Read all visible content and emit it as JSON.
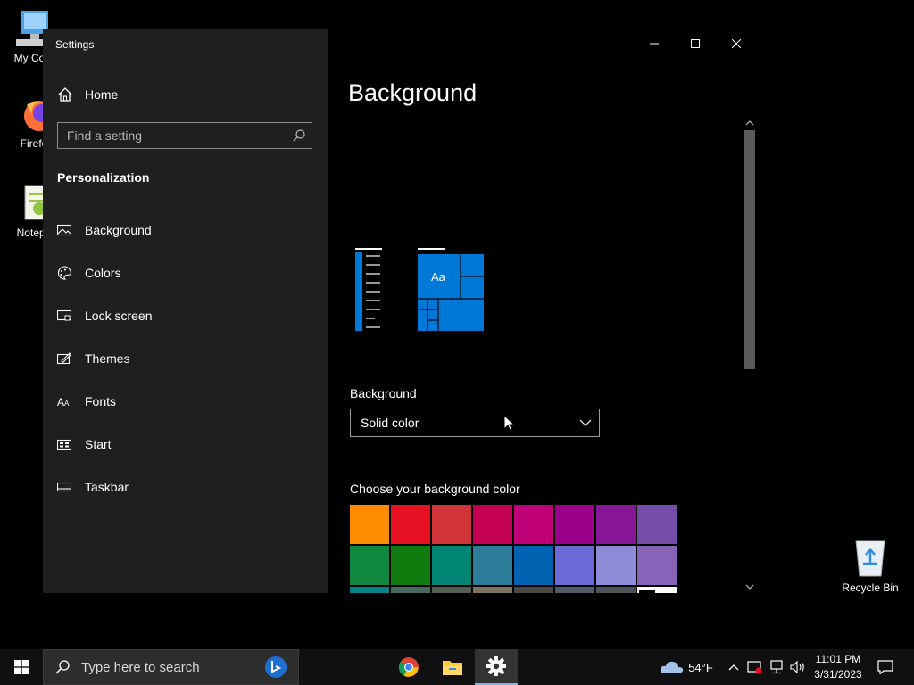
{
  "desktop": {
    "icons": [
      {
        "label": "My Com"
      },
      {
        "label": "Firefo"
      },
      {
        "label": "Notepa"
      }
    ],
    "recycle_bin": "Recycle Bin"
  },
  "window": {
    "title": "Settings",
    "home_label": "Home",
    "search_placeholder": "Find a setting",
    "section_title": "Personalization",
    "nav": [
      {
        "label": "Background",
        "icon": "picture-icon"
      },
      {
        "label": "Colors",
        "icon": "palette-icon"
      },
      {
        "label": "Lock screen",
        "icon": "lock-screen-icon"
      },
      {
        "label": "Themes",
        "icon": "themes-icon"
      },
      {
        "label": "Fonts",
        "icon": "fonts-icon"
      },
      {
        "label": "Start",
        "icon": "start-icon"
      },
      {
        "label": "Taskbar",
        "icon": "taskbar-icon"
      }
    ]
  },
  "main": {
    "page_title": "Background",
    "preview_text": "Aa",
    "background_label": "Background",
    "background_value": "Solid color",
    "color_label": "Choose your background color",
    "swatch_colors": [
      [
        "#ff8c00",
        "#e81123",
        "#d13438",
        "#c30052",
        "#bf0077",
        "#9a0089",
        "#881798",
        "#744da9"
      ],
      [
        "#10893e",
        "#107c10",
        "#018574",
        "#2d7d9a",
        "#0063b1",
        "#6b69d6",
        "#8e8cd8",
        "#8764b8"
      ],
      [
        "#038387",
        "#486860",
        "#525e54",
        "#7e735f",
        "#4c4a48",
        "#515c6b",
        "#4a5459",
        "#000000"
      ]
    ],
    "accent_color": "#0078d7"
  },
  "taskbar": {
    "search_placeholder": "Type here to search",
    "weather_temp": "54°F",
    "time": "11:01 PM",
    "date": "3/31/2023"
  }
}
